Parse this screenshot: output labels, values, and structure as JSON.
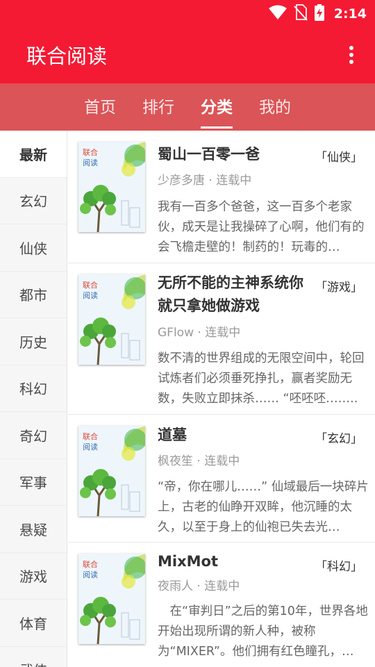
{
  "status_bar": {
    "time": "2:14",
    "icons": [
      "wifi-icon",
      "no-sim-icon",
      "battery-charging-icon"
    ]
  },
  "app_bar": {
    "title": "联合阅读",
    "menu_icon": "more-vert-icon"
  },
  "tabs": [
    {
      "label": "首页",
      "active": false
    },
    {
      "label": "排行",
      "active": false
    },
    {
      "label": "分类",
      "active": true
    },
    {
      "label": "我的",
      "active": false
    }
  ],
  "categories": [
    "最新",
    "玄幻",
    "仙侠",
    "都市",
    "历史",
    "科幻",
    "奇幻",
    "军事",
    "悬疑",
    "游戏",
    "体育",
    "武侠"
  ],
  "cover": {
    "brand_line1": "联合",
    "brand_line2": "阅读"
  },
  "books": [
    {
      "title": "蜀山一百零一爸",
      "tag": "「仙侠」",
      "meta": "少彦多唐 · 连载中",
      "desc": "我有一百多个爸爸，这一百多个老家伙，成天是让我操碎了心啊，他们有的会飞檐走壁的！制药的！玩毒的…"
    },
    {
      "title": "无所不能的主神系统你就只拿她做游戏",
      "tag": "「游戏」",
      "meta": "GFlow · 连载中",
      "desc": "数不清的世界组成的无限空间中，轮回试炼者们必须垂死挣扎，赢者奖励无数，失败立即抹杀…… “呸呸呸…….."
    },
    {
      "title": "道墓",
      "tag": "「玄幻」",
      "meta": "枫夜笙 · 连载中",
      "desc": "“帝，你在哪儿……” 仙域最后一块碎片上，古老的仙睁开双眸，他沉睡的太久，以至于身上的仙袍已失去光…"
    },
    {
      "title": "MixMot",
      "tag": "「科幻」",
      "meta": "夜雨人 · 连载中",
      "desc": "　在“审判日”之后的第10年，世界各地开始出现所谓的新人种，被称为“MIXER”。他们拥有红色瞳孔，…"
    }
  ],
  "colors": {
    "primary": "#f41a34",
    "tab_bar": "#db5457"
  }
}
